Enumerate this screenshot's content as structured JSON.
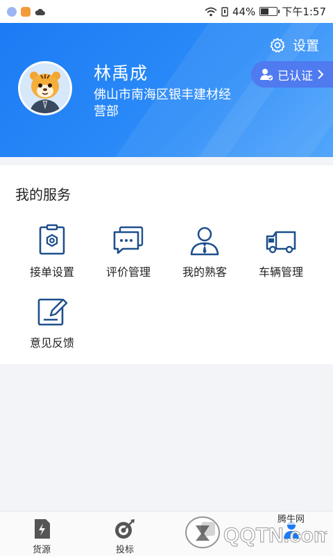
{
  "status_bar": {
    "battery_text": "44%",
    "battery_level": 0.44,
    "time": "下午1:57",
    "icons": [
      "music-app-icon",
      "orange-app-icon",
      "cloud-icon",
      "wifi-icon",
      "sim-icon",
      "battery-icon"
    ]
  },
  "header": {
    "settings_label": "设置",
    "user_name": "林禹成",
    "company": "佛山市南海区银丰建材经营部",
    "verified_label": "已认证",
    "colors": {
      "bg_start": "#1c7bf4",
      "bg_end": "#52a6fb",
      "badge": "#4f7af0"
    }
  },
  "services": {
    "title": "我的服务",
    "items": [
      {
        "label": "接单设置",
        "icon": "order-settings-icon"
      },
      {
        "label": "评价管理",
        "icon": "review-management-icon"
      },
      {
        "label": "我的熟客",
        "icon": "regular-customers-icon"
      },
      {
        "label": "车辆管理",
        "icon": "vehicle-management-icon"
      },
      {
        "label": "意见反馈",
        "icon": "feedback-icon"
      }
    ],
    "icon_color": "#1e4f8c"
  },
  "tabbar": {
    "tabs": [
      {
        "label": "货源",
        "icon": "cargo-source-icon"
      },
      {
        "label": "投标",
        "icon": "bid-target-icon"
      },
      {
        "label": "",
        "icon": "tab3-icon"
      },
      {
        "label": "",
        "icon": "tab4-icon"
      }
    ]
  },
  "watermark": {
    "text": "腾牛网",
    "logo_text": "QQTN.com"
  }
}
